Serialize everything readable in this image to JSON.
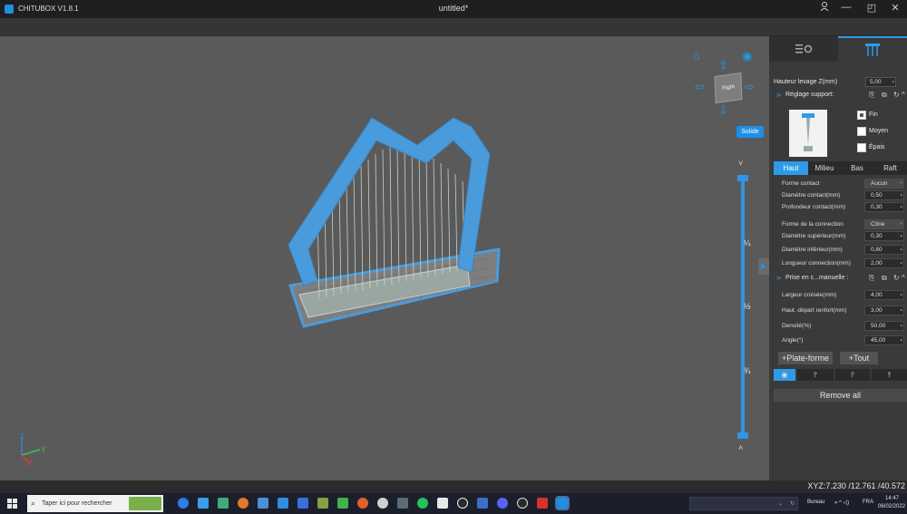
{
  "window": {
    "app_name": "CHITUBOX V1.8.1",
    "doc_title": "untitled*",
    "user_icon": "user-icon",
    "minimize": "—",
    "maximize": "◰",
    "close": "✕"
  },
  "viewport": {
    "view_label": "Right",
    "render_mode": "Solide",
    "slider_marks": [
      "¼",
      "½",
      "¾"
    ],
    "chev_up": "˅",
    "chev_down": "˄",
    "axis_z": "Z",
    "axis_y": "Y",
    "axis_x": "X",
    "panel_toggle": "▶",
    "model_color": "#4a9bdc",
    "support_color": "#c8d0cc",
    "plate_color": "#4a9bdc"
  },
  "sidebar": {
    "lift_label": "Hauteur levage Z(mm)",
    "lift_value": "5,00",
    "support_settings_label": "Réglage support:",
    "density_options": [
      "Fin",
      "Moyen",
      "Épais"
    ],
    "selected_density": "Fin",
    "tabs": [
      "Haut",
      "Milieu",
      "Bas",
      "Raft"
    ],
    "active_tab": "Haut",
    "params": [
      {
        "label": "Forme contact",
        "value": "Aucun",
        "type": "select"
      },
      {
        "label": "Diamètre contact(mm)",
        "value": "0,50",
        "type": "number"
      },
      {
        "label": "Profondeur contact(mm)",
        "value": "0,30",
        "type": "number"
      },
      {
        "label": "Forme de la connection",
        "value": "Cône",
        "type": "select"
      },
      {
        "label": "Diamètre supérieur(mm)",
        "value": "0,30",
        "type": "number"
      },
      {
        "label": "Diamètre inférieur(mm)",
        "value": "0,80",
        "type": "number"
      },
      {
        "label": "Longueur connection(mm)",
        "value": "2,00",
        "type": "number"
      }
    ],
    "manual_label": "Prise en c...manuelle :",
    "manual_params": [
      {
        "label": "Largeur croisée(mm)",
        "value": "4,00"
      },
      {
        "label": "Haut. départ renfort(mm)",
        "value": "3,00"
      },
      {
        "label": "Densité(%)",
        "value": "50,00"
      },
      {
        "label": "Angle(°)",
        "value": "45,00"
      }
    ],
    "add_platform": "+Plate-forme",
    "add_all": "+Tout",
    "remove_all": "Remove all",
    "coords": "XYZ:7.230 /12.761 /40.572"
  },
  "taskbar": {
    "search_placeholder": "Taper ici pour rechercher",
    "desktop_label": "Bureau",
    "lang": "FRA",
    "time": "14:47",
    "date": "06/02/2022"
  }
}
